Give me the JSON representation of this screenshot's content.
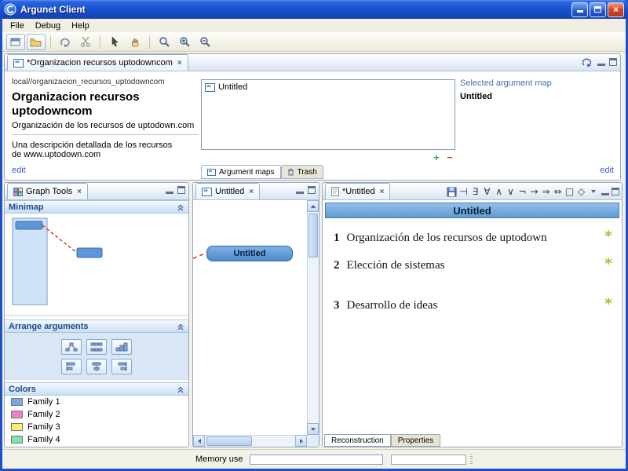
{
  "window": {
    "title": "Argunet Client"
  },
  "menu": {
    "items": [
      {
        "label": "File"
      },
      {
        "label": "Debug"
      },
      {
        "label": "Help"
      }
    ]
  },
  "icons": {
    "close": "×",
    "add": "+",
    "remove": "−",
    "star": "*"
  },
  "editor": {
    "tab_label": "*Organizacion recursos uptodowncom",
    "details": {
      "path": "local//organizacion_recursos_uptodowncom",
      "title": "Organizacion recursos uptodowncom",
      "subtitle": "Organización de los recursos de uptodown.com",
      "description": "Una descripción detallada de los recursos de www.uptodown.com",
      "edit_link": "edit"
    },
    "maps_panel": {
      "items": [
        {
          "label": "Untitled"
        }
      ],
      "tabs": [
        {
          "label": "Argument maps"
        },
        {
          "label": "Trash"
        }
      ]
    },
    "selected_panel": {
      "heading": "Selected argument map",
      "value": "Untitled",
      "edit_link": "edit"
    }
  },
  "graph_tools": {
    "tab_label": "Graph Tools",
    "minimap_title": "Minimap",
    "arrange_title": "Arrange arguments",
    "colors_title": "Colors",
    "families": [
      {
        "label": "Family 1",
        "color": "#79a8e0"
      },
      {
        "label": "Family 2",
        "color": "#f07fd0"
      },
      {
        "label": "Family 3",
        "color": "#f8f06a"
      },
      {
        "label": "Family 4",
        "color": "#7fe0b0"
      }
    ]
  },
  "canvas": {
    "tab_label": "Untitled",
    "node_label": "Untitled"
  },
  "reconstruction": {
    "tab_label": "*Untitled",
    "header": "Untitled",
    "items": [
      {
        "num": "1",
        "text": "Organización de los recursos de uptodown"
      },
      {
        "num": "2",
        "text": "Elección de sistemas"
      },
      {
        "num": "3",
        "text": "Desarrollo de ideas"
      }
    ],
    "bottom_tabs": [
      {
        "label": "Reconstruction"
      },
      {
        "label": "Properties"
      }
    ],
    "symbols": [
      "⊣",
      "∃",
      "∀",
      "∧",
      "∨",
      "¬",
      "→",
      "⇒",
      "⇔",
      "□",
      "◇"
    ]
  },
  "status": {
    "memory_label": "Memory use"
  }
}
